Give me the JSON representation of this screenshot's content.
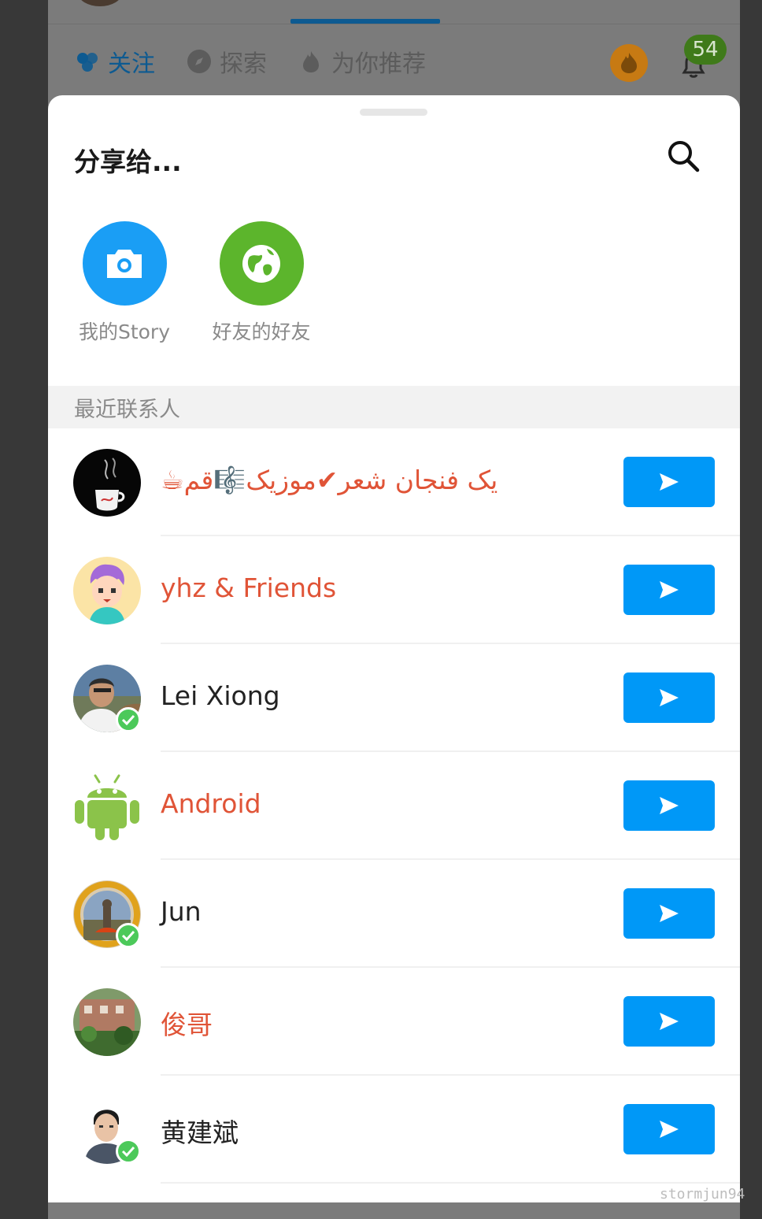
{
  "background_app": {
    "tabs": [
      {
        "label": "关注",
        "icon": "follow-icon",
        "active": true
      },
      {
        "label": "探索",
        "icon": "compass-icon",
        "active": false
      },
      {
        "label": "为你推荐",
        "icon": "flame-outline-icon",
        "active": false
      }
    ],
    "notification_count": "54",
    "accent_color": "#0d5a91"
  },
  "share_sheet": {
    "title": "分享给...",
    "search_icon": "search-icon",
    "targets": [
      {
        "label": "我的Story",
        "icon": "camera-icon",
        "color": "#1a9ef5"
      },
      {
        "label": "好友的好友",
        "icon": "globe-icon",
        "color": "#5cb52c"
      }
    ],
    "section_header": "最近联系人",
    "contacts": [
      {
        "name": "☕یک فنجان شعر✔موزیک🎼قم",
        "name_color": "#e05437",
        "verified": false,
        "avatar": "coffee-avatar"
      },
      {
        "name": "yhz & Friends",
        "name_color": "#e05437",
        "verified": false,
        "avatar": "cartoon-avatar"
      },
      {
        "name": "Lei Xiong",
        "name_color": "#222222",
        "verified": true,
        "avatar": "photo-avatar"
      },
      {
        "name": "Android",
        "name_color": "#e05437",
        "verified": false,
        "avatar": "android-avatar"
      },
      {
        "name": "Jun",
        "name_color": "#222222",
        "verified": true,
        "avatar": "photo-avatar"
      },
      {
        "name": "俊哥",
        "name_color": "#e05437",
        "verified": false,
        "avatar": "photo-avatar"
      },
      {
        "name": "黄建斌",
        "name_color": "#222222",
        "verified": true,
        "avatar": "photo-avatar"
      }
    ],
    "send_color": "#0098f7"
  },
  "watermark": "stormjun94"
}
